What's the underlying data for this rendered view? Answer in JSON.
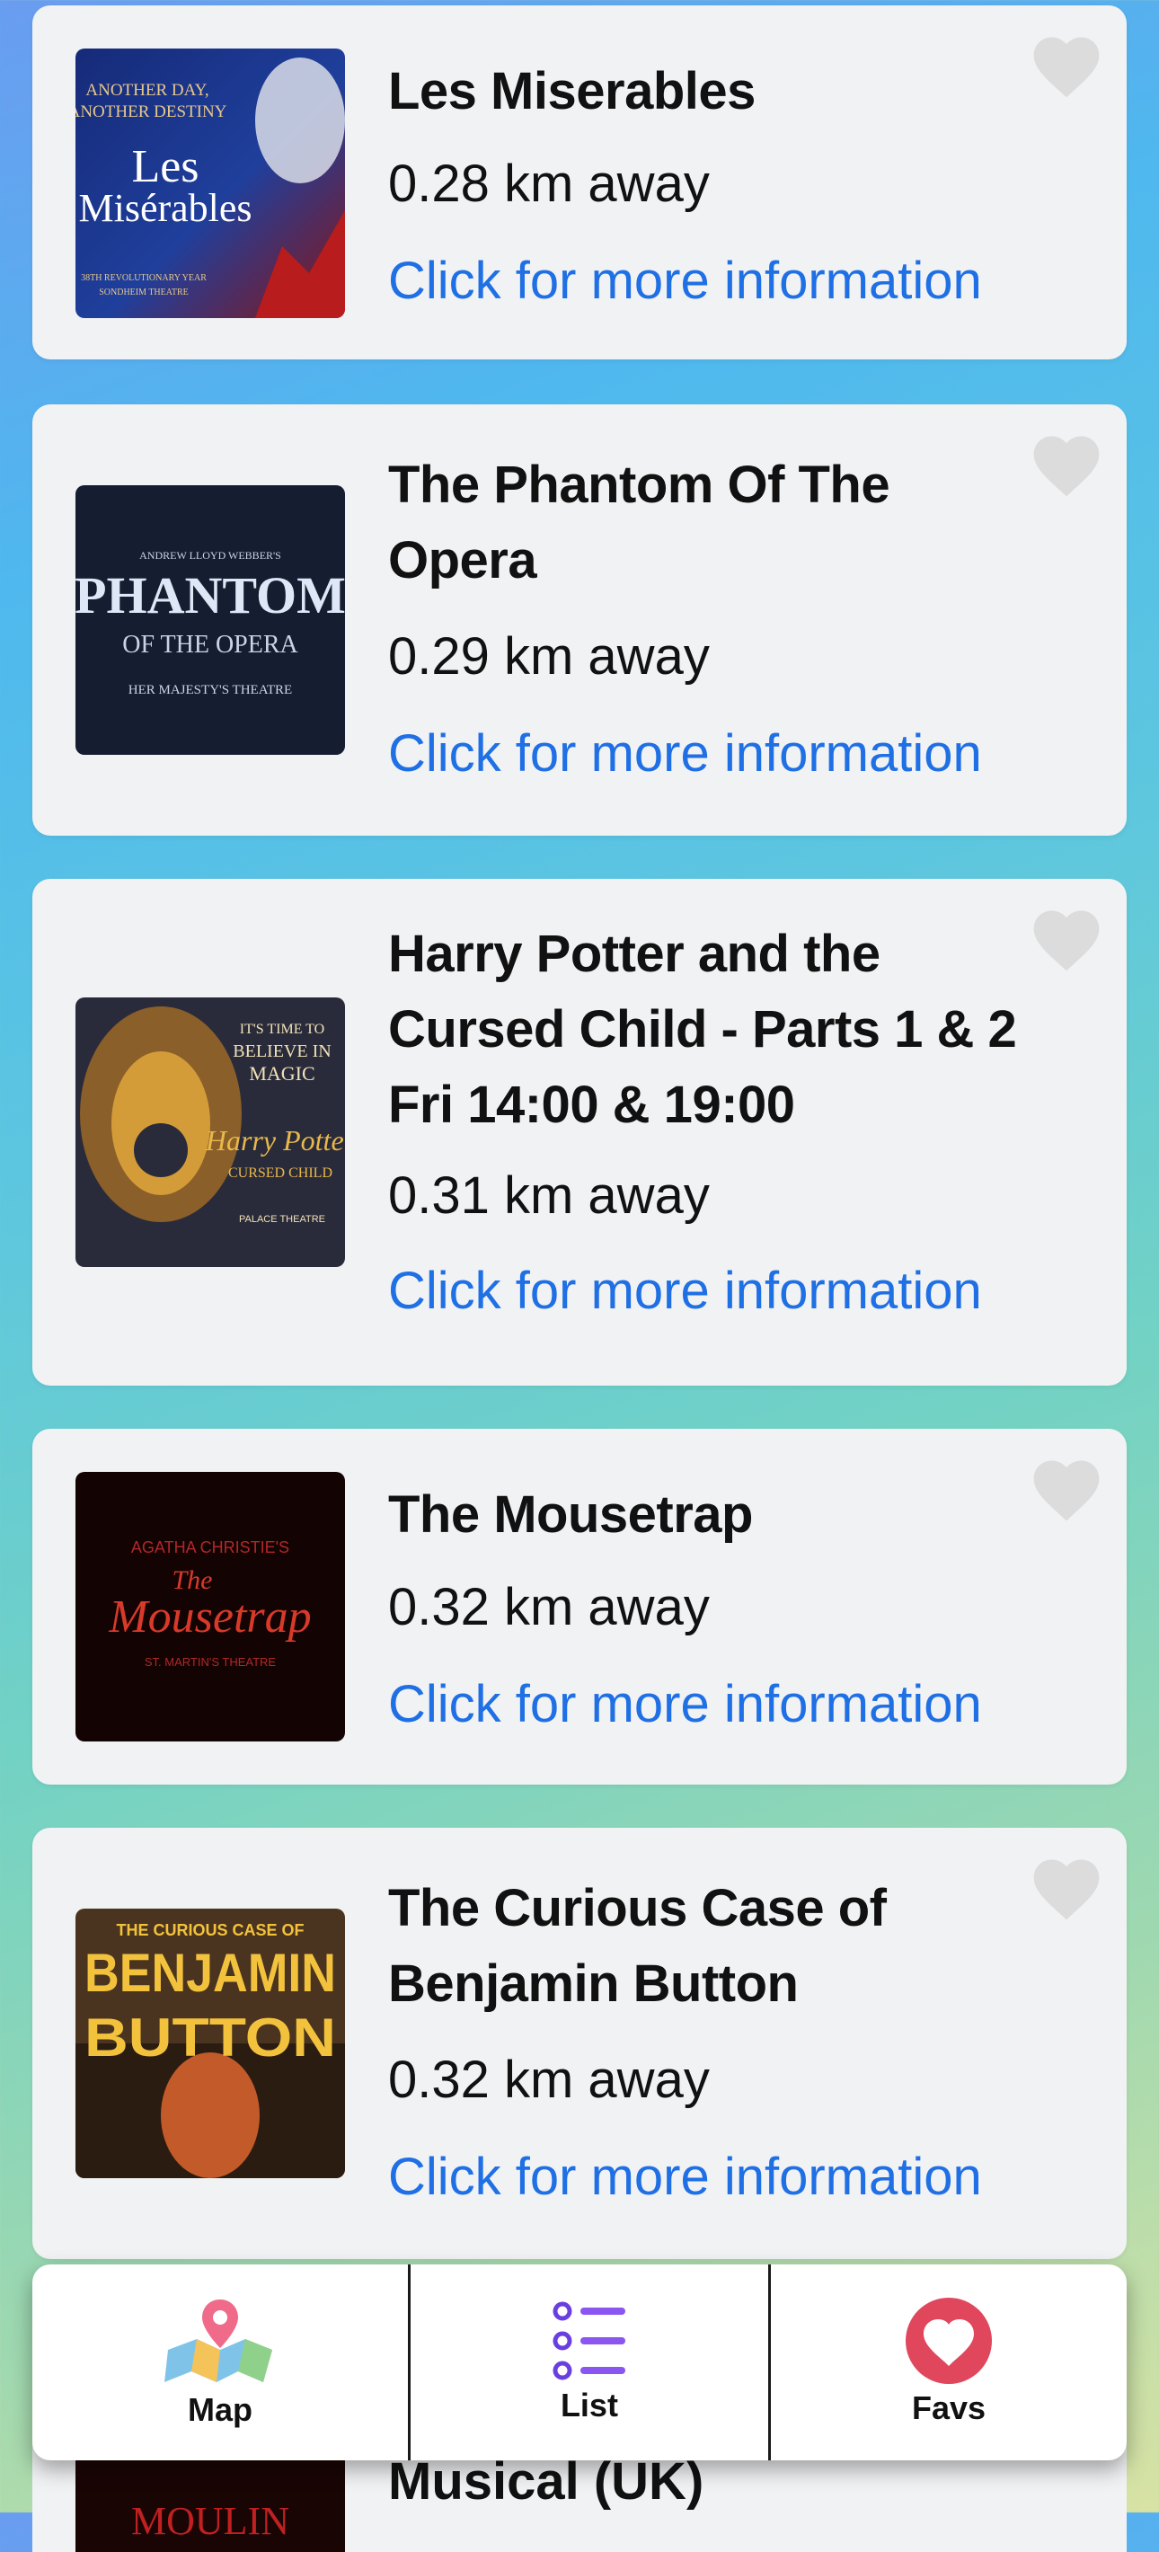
{
  "shows": [
    {
      "title": "Les Miserables",
      "distance": "0.28 km away",
      "link_label": "Click for more information",
      "poster": {
        "line1": "ANOTHER DAY,",
        "line2": "ANOTHER DESTINY",
        "main1": "Les",
        "main2": "Misérables",
        "sub1": "38TH REVOLUTIONARY YEAR",
        "sub2": "SONDHEIM THEATRE"
      }
    },
    {
      "title": "The Phantom Of The Opera",
      "distance": "0.29 km away",
      "link_label": "Click for more information",
      "poster": {
        "line1": "ANDREW LLOYD WEBBER'S",
        "main1": "PHANTOM",
        "main2": "OF THE OPERA",
        "sub1": "HER MAJESTY'S THEATRE"
      }
    },
    {
      "title": "Harry Potter and the Cursed Child - Parts 1 & 2 Fri 14:00 & 19:00",
      "distance": "0.31 km away",
      "link_label": "Click for more information",
      "poster": {
        "line1": "IT'S TIME TO",
        "line2": "BELIEVE IN",
        "line3": "MAGIC",
        "main1": "Harry Potter",
        "main2": "CURSED CHILD",
        "sub1": "PALACE THEATRE"
      }
    },
    {
      "title": "The Mousetrap",
      "distance": "0.32 km away",
      "link_label": "Click for more information",
      "poster": {
        "line1": "AGATHA CHRISTIE'S",
        "main1": "The",
        "main2": "Mousetrap",
        "sub1": "ST. MARTIN'S THEATRE"
      }
    },
    {
      "title": "The Curious Case of Benjamin Button",
      "distance": "0.32 km away",
      "link_label": "Click for more information",
      "poster": {
        "line1": "THE CURIOUS CASE OF",
        "main1": "BENJAMIN",
        "main2": "BUTTON"
      }
    }
  ],
  "peek": {
    "title": "Musical (UK)",
    "poster_text": "MOULIN"
  },
  "tabbar": {
    "map_label": "Map",
    "list_label": "List",
    "favs_label": "Favs"
  },
  "colors": {
    "link": "#1f6fe5",
    "heart_inactive": "#dcdcdc",
    "favs_accent": "#e0475d",
    "list_accent": "#6a3fe0"
  }
}
